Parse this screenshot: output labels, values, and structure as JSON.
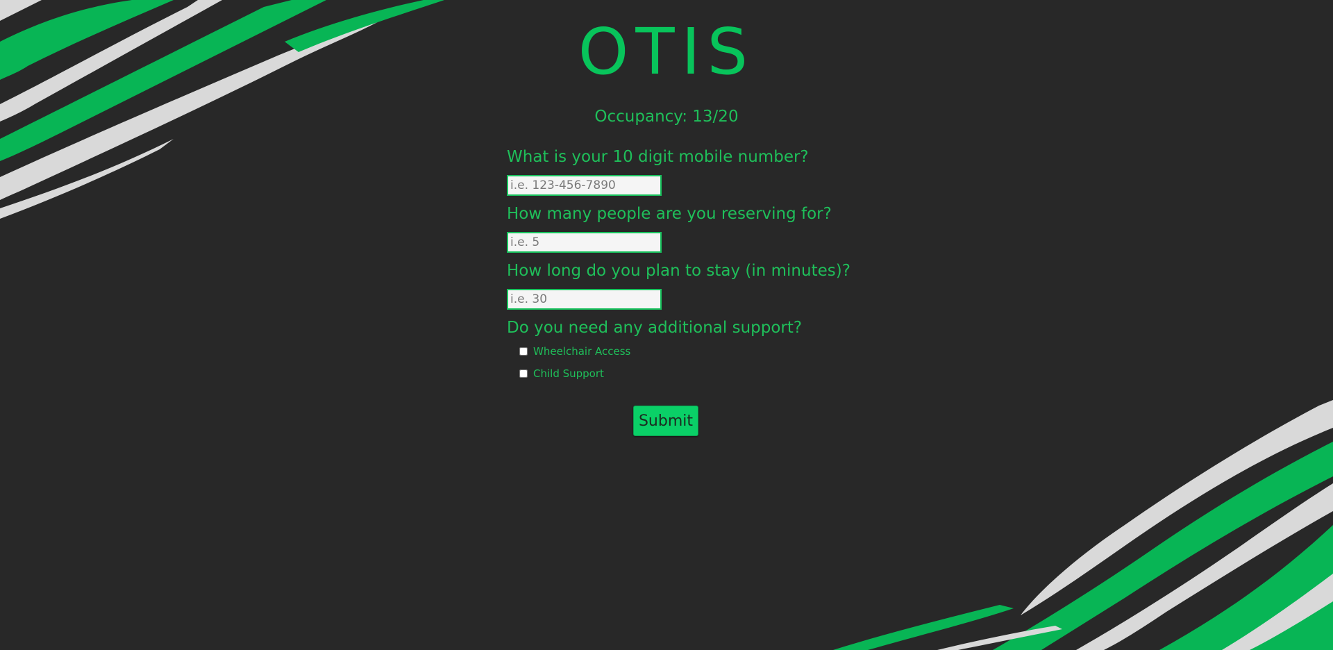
{
  "app": {
    "title": "OTIS",
    "occupancy": "Occupancy: 13/20"
  },
  "form": {
    "phone": {
      "label": "What is your 10 digit mobile number?",
      "placeholder": "i.e. 123-456-7890"
    },
    "party_size": {
      "label": "How many people are you reserving for?",
      "placeholder": "i.e. 5"
    },
    "duration": {
      "label": "How long do you plan to stay (in minutes)?",
      "placeholder": "i.e. 30"
    },
    "support": {
      "label": "Do you need any additional support?",
      "options": [
        {
          "label": "Wheelchair Access",
          "checked": false
        },
        {
          "label": "Child Support",
          "checked": false
        }
      ]
    },
    "submit_label": "Submit"
  },
  "theme": {
    "background": "#282828",
    "accent": "#08c45b",
    "stroke_light": "#d9d9d9"
  }
}
